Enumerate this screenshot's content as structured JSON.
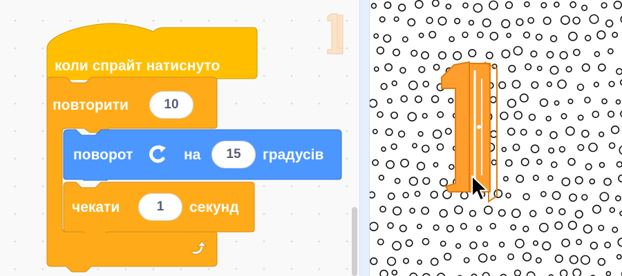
{
  "code_area": {
    "hat_block": {
      "label": "коли спрайт натиснуто",
      "color": "#FFBF00"
    },
    "repeat_block": {
      "label": "повторити",
      "count": "10",
      "color": "#FFAB19",
      "loop_icon": "loop-arrow-icon"
    },
    "turn_block": {
      "label": "поворот",
      "icon": "rotate-clockwise-icon",
      "on_label": "на",
      "degrees": "15",
      "units_label": "градусів",
      "color": "#4C97FF"
    },
    "wait_block": {
      "label": "чекати",
      "seconds": "1",
      "units_label": "секунд",
      "color": "#FFAB19"
    }
  },
  "stage": {
    "backdrop": "polka-dots",
    "sprite": "letter-i-sprite",
    "sprite_color": "#FF9E2C",
    "cursor": "arrow-cursor-icon"
  }
}
